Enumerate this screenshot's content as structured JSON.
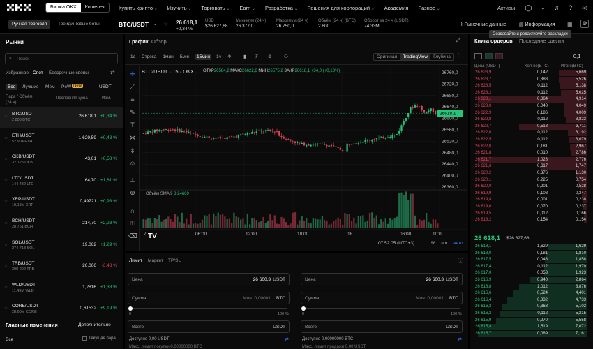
{
  "nav": {
    "logo": "OKX",
    "seg": [
      "Биржа OKX",
      "Кошелек"
    ],
    "menu": [
      "Купить крипто",
      "Изучить",
      "Торговать",
      "Earn",
      "Разработка",
      "Решения для корпораций",
      "Академия",
      "Разное"
    ],
    "assets": "Активы"
  },
  "ticker": {
    "tab1": "Ручная торговля",
    "tab2": "Трейдинговые боты",
    "pair": "BTC/USDT",
    "price": "26 618,1",
    "change": "+0,34 %",
    "usd_label": "USD",
    "usd_value": "$26 627,68",
    "min_label": "Минимум (24 ч)",
    "min_value": "26 377,0",
    "max_label": "Максимум (24 ч)",
    "max_value": "26 750,0",
    "volbtc_label": "Объём (24 ч) (BTC)",
    "volbtc_value": "2 800",
    "turnover_label": "Оборот за 24 ч (USDT)",
    "turnover_value": "74,33M",
    "market_data": "Рыночные данные",
    "info": "Информация",
    "tooltip": "Создавайте и редактируйте раскладки"
  },
  "markets": {
    "title": "Рынки",
    "search_placeholder": "Поиск",
    "tabs": [
      "Избранное",
      "Спот",
      "Бессрочные свопы"
    ],
    "sub": [
      "Все",
      "Лучшие",
      "Мем",
      "PoW"
    ],
    "new_badge": "New",
    "quote": "USDT",
    "col_pair": "Пара / Объём (24 ч)",
    "col_price": "Последняя цена",
    "col_change": "Изм.",
    "rows": [
      {
        "name": "BTC/USDT",
        "vol": "2 800 BTC",
        "price": "26 618,1",
        "change": "+0,34 %",
        "up": true
      },
      {
        "name": "ETH/USDT",
        "vol": "52 904 ETH",
        "price": "1 629,59",
        "change": "+0,43 %",
        "up": true
      },
      {
        "name": "OKB/USDT",
        "vol": "32 125 OKB",
        "price": "43,61",
        "change": "+0,58 %",
        "up": true
      },
      {
        "name": "LTC/USDT",
        "vol": "144 432 LTC",
        "price": "64,70",
        "change": "+1,81 %",
        "up": true
      },
      {
        "name": "XRP/USDT",
        "vol": "19,18M XRP",
        "price": "0,49721",
        "change": "+0,93 %",
        "up": true
      },
      {
        "name": "BCH/USDT",
        "vol": "28 761 BCH",
        "price": "214,70",
        "change": "+2,23 %",
        "up": true
      },
      {
        "name": "SOL/USDT",
        "vol": "274 718 SOL",
        "price": "19,062",
        "change": "+1,29 %",
        "up": true
      },
      {
        "name": "TRB/USDT",
        "vol": "300 202 TRB",
        "price": "26,066",
        "change": "-3,48 %",
        "up": false
      },
      {
        "name": "WLD/USDT",
        "vol": "11,49M WLD",
        "price": "1,2816",
        "change": "+1,38 %",
        "up": true
      },
      {
        "name": "CORE/USDT",
        "vol": "28,60M CORE",
        "price": "0,61532",
        "change": "+9,19 %",
        "up": true
      }
    ],
    "bottom_title": "Главные изменения",
    "bottom_more": "Дополнительно",
    "bottom_all": "Все",
    "bottom_current": "Текущая пара"
  },
  "chart": {
    "tab_chart": "График",
    "tab_overview": "Обзор",
    "intervals": [
      "1с",
      "Строка",
      "1мин",
      "5мин",
      "15мин",
      "1ч",
      "4ч"
    ],
    "active_interval": "15мин",
    "views": [
      "Оригинал",
      "TradingView",
      "Глубина"
    ],
    "symbol": "BTC/USDT",
    "tf": "15",
    "exch": "OKX",
    "open_l": "ОТКР",
    "open_v": "26584,2",
    "high_l": "МАКС",
    "high_v": "26622,6",
    "low_l": "МИН",
    "low_v": "26575,2",
    "close_l": "ЗАКР",
    "close_v": "26618,1",
    "delta": "+34,0 (+0,13%)",
    "vol_l": "Объём",
    "sma_l": "SMA 9",
    "sma_v": "8,24669",
    "price_ticks": [
      "26760,0",
      "26720,0",
      "26680,0",
      "26640,0",
      "26600,0",
      "26560,0",
      "26520,0",
      "26480,0",
      "26440,0",
      "26400,0",
      "26360,0"
    ],
    "last_price": "26618,1",
    "time_ticks": [
      "7",
      "06:00",
      "12:00",
      "18:00",
      "18",
      "06:00",
      "10:0"
    ],
    "clock": "07:52:05 (UTC+3)",
    "pct": "%",
    "log": "лог",
    "auto": "авто"
  },
  "order": {
    "tabs": [
      "Лимит",
      "Маркет",
      "TP/SL"
    ],
    "price_label": "Цена",
    "price_value": "26 600,3",
    "unit_usdt": "USDT",
    "sum_label": "Сумма",
    "sum_placeholder": "Мин. 0,00001",
    "unit_btc": "BTC",
    "min_pct": "0",
    "max_pct": "100 %",
    "total_label": "Всего",
    "avail1": "Доступно 0,00 USDT",
    "avail2": "Доступно 0,00000000 BTC",
    "maxbuy": "Макс. лимит покупки 0,00000000 BTC",
    "maxsell": "Макс. лимит продажи 0,00 USDT"
  },
  "book": {
    "tab1": "Книга ордеров",
    "tab2": "Последние сделки",
    "step": "0,1",
    "col_p": "Цена (USDT)",
    "col_q": "Кол-во(BTC)",
    "col_t": "Итого(BTC)",
    "asks": [
      [
        "26 623,9",
        "0,142",
        "5,669",
        0.25
      ],
      [
        "26 623,7",
        "0,388",
        "5,526",
        0.25
      ],
      [
        "26 623,5",
        "0,112",
        "5,138",
        0.24
      ],
      [
        "26 623,2",
        "0,112",
        "5,025",
        0.23
      ],
      [
        "26 623,1",
        "0,864",
        "4,914",
        0.96
      ],
      [
        "26 623,0",
        "0,040",
        "4,049",
        0.2
      ],
      [
        "26 622,9",
        "0,186",
        "4,009",
        0.2
      ],
      [
        "26 622,8",
        "0,112",
        "3,823",
        0.19
      ],
      [
        "26 622,7",
        "0,518",
        "3,711",
        0.6
      ],
      [
        "26 622,6",
        "0,112",
        "3,192",
        0.17
      ],
      [
        "26 622,5",
        "0,112",
        "3,079",
        0.16
      ],
      [
        "26 622,0",
        "0,181",
        "2,967",
        0.15
      ],
      [
        "26 621,8",
        "0,010",
        "2,786",
        0.14
      ],
      [
        "26 621,7",
        "1,028",
        "2,776",
        0.96
      ],
      [
        "26 621,6",
        "0,617",
        "1,747",
        0.4
      ],
      [
        "26 620,2",
        "0,376",
        "1,130",
        0.1
      ],
      [
        "26 620,1",
        "0,225",
        "0,754",
        0.08
      ],
      [
        "26 620,0",
        "0,201",
        "0,528",
        0.06
      ],
      [
        "26 619,9",
        "0,108",
        "0,347",
        0.05
      ],
      [
        "26 619,8",
        "0,001",
        "0,238",
        0.04
      ],
      [
        "26 619,6",
        "0,070",
        "0,237",
        0.04
      ],
      [
        "26 619,5",
        "0,012",
        "0,166",
        0.03
      ],
      [
        "26 618,2",
        "0,154",
        "0,154",
        0.03
      ]
    ],
    "mid_price": "26 618,1",
    "mid_usd": "$26 627,68",
    "bids": [
      [
        "26 618,1",
        "1,629",
        "1,629",
        0.35
      ],
      [
        "26 618,0",
        "0,181",
        "1,810",
        0.36
      ],
      [
        "26 617,5",
        "0,048",
        "1,858",
        0.37
      ],
      [
        "26 617,4",
        "0,112",
        "1,970",
        0.38
      ],
      [
        "26 617,0",
        "0,053",
        "1,923",
        0.38
      ],
      [
        "26 616,9",
        "0,940",
        "2,864",
        0.5
      ],
      [
        "26 616,8",
        "1,012",
        "3,876",
        0.6
      ],
      [
        "26 616,6",
        "0,524",
        "4,401",
        0.65
      ],
      [
        "26 616,4",
        "0,332",
        "4,733",
        0.7
      ],
      [
        "26 616,3",
        "0,368",
        "5,102",
        0.75
      ],
      [
        "26 616,2",
        "0,112",
        "5,215",
        0.77
      ],
      [
        "26 615,9",
        "0,270",
        "5,558",
        0.8
      ],
      [
        "26 615,8",
        "1,519",
        "7,072",
        0.95
      ],
      [
        "26 615,7",
        "0,089",
        "7,161",
        0.96
      ]
    ]
  }
}
